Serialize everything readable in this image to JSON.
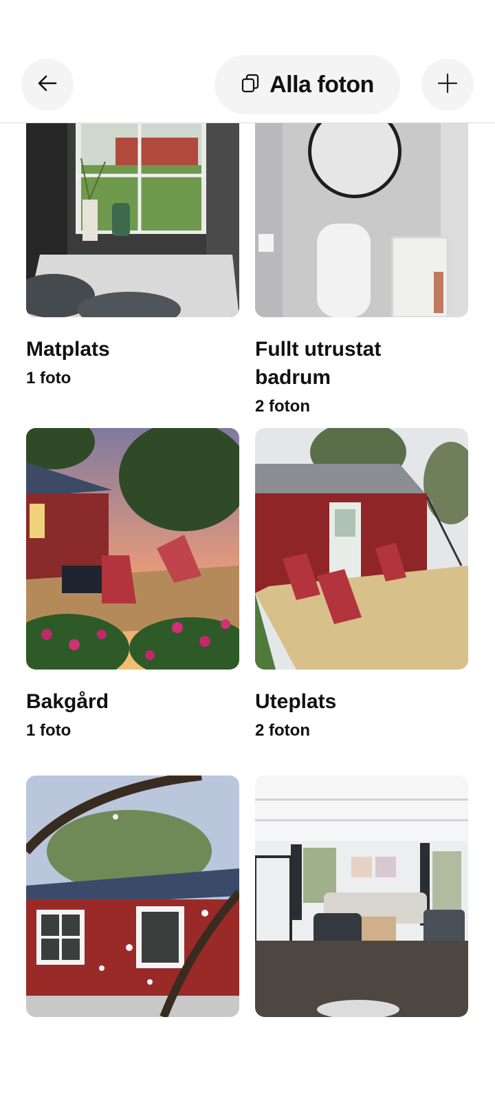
{
  "header": {
    "back_icon": "arrow-left-icon",
    "title": "Alla foton",
    "title_icon": "photo-stack-icon",
    "add_icon": "plus-icon"
  },
  "gallery": [
    {
      "title": "Matplats",
      "count": "1 foto"
    },
    {
      "title": "Fullt utrustat badrum",
      "count": "2 foton"
    },
    {
      "title": "Bakgård",
      "count": "1 foto"
    },
    {
      "title": "Uteplats",
      "count": "2 foton"
    },
    {
      "title": "",
      "count": ""
    },
    {
      "title": "",
      "count": ""
    }
  ]
}
